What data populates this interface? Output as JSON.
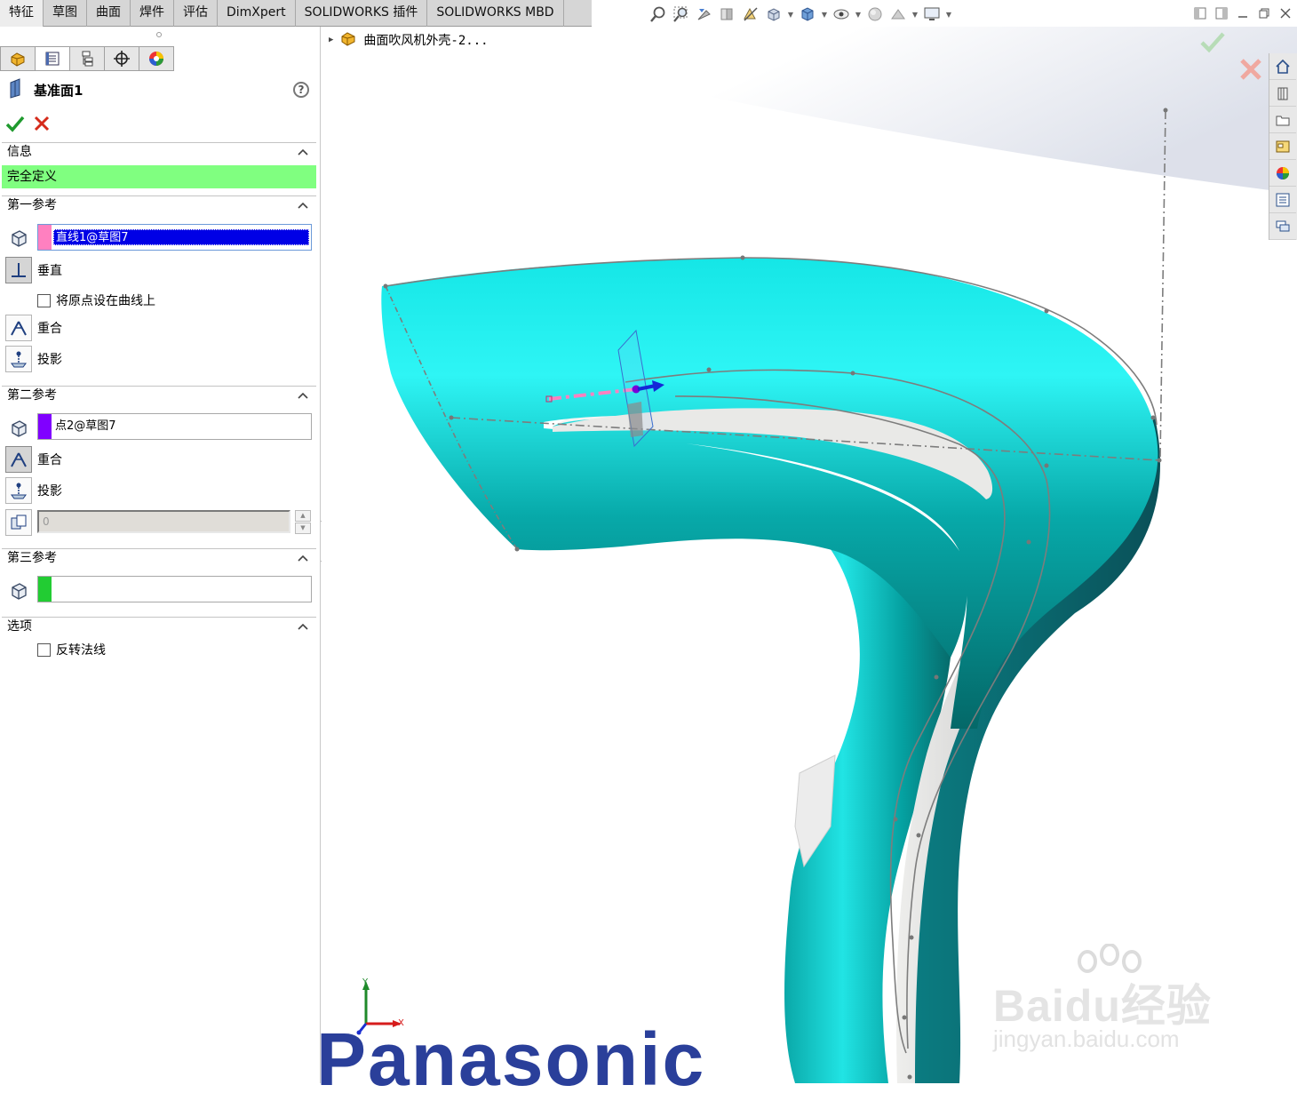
{
  "command_tabs": [
    "特征",
    "草图",
    "曲面",
    "焊件",
    "评估",
    "DimXpert",
    "SOLIDWORKS 插件",
    "SOLIDWORKS MBD"
  ],
  "feature_tree": {
    "item_label": "曲面吹风机外壳-2..."
  },
  "property_manager": {
    "title": "基准面1",
    "help_icon": "?",
    "info": {
      "header": "信息",
      "status": "完全定义",
      "status_color": "#80ff80"
    },
    "first_reference": {
      "header": "第一参考",
      "selection": "直线1@草图7",
      "selection_color": "#ff80c0",
      "constraints": {
        "perpendicular": "垂直",
        "origin_on_curve": "将原点设在曲线上",
        "coincident": "重合",
        "project": "投影"
      }
    },
    "second_reference": {
      "header": "第二参考",
      "selection": "点2@草图7",
      "selection_color": "#8000ff",
      "constraints": {
        "coincident": "重合",
        "project": "投影"
      },
      "distance_value": "0"
    },
    "third_reference": {
      "header": "第三参考",
      "selection": "",
      "selection_color": "#22cc33"
    },
    "options": {
      "header": "选项",
      "flip_normal": "反转法线"
    }
  },
  "viewport": {
    "model_color": "#00d6d6",
    "triad": {
      "x_label": "X",
      "y_label": "Y"
    },
    "brand_text": "Panasonic",
    "watermark": {
      "line1": "Baidu经验",
      "line2": "jingyan.baidu.com"
    }
  },
  "icons": {
    "toolbar": [
      "zoom-to-fit-icon",
      "zoom-area-icon",
      "previous-view-icon",
      "section-view-icon",
      "dynamic-annotation-icon",
      "view-orientation-icon",
      "display-style-icon",
      "hide-show-icon",
      "edit-appearance-icon",
      "apply-scene-icon",
      "view-settings-icon"
    ],
    "task_pane": [
      "home-icon",
      "resources-icon",
      "design-library-icon",
      "file-explorer-icon",
      "appearances-icon",
      "custom-properties-icon",
      "forum-icon"
    ]
  }
}
